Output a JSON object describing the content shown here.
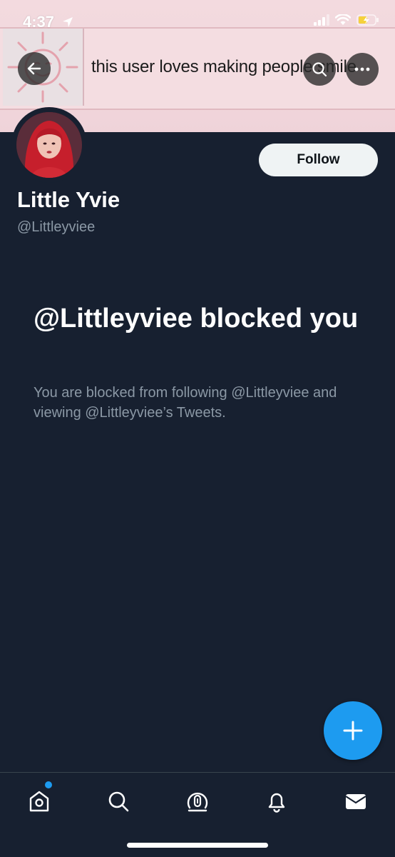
{
  "status_bar": {
    "time": "4:37"
  },
  "banner": {
    "text": "this user loves making people smile"
  },
  "profile": {
    "display_name": "Little Yvie",
    "handle": "@Littleyviee",
    "follow_label": "Follow"
  },
  "blocked": {
    "title": "@Littleyviee blocked you",
    "description": "You are blocked from following @Littleyviee and viewing @Littleyviee’s Tweets."
  },
  "tabbar": {
    "items": [
      "home-icon",
      "search-icon",
      "spaces-icon",
      "notifications-icon",
      "messages-icon"
    ]
  },
  "colors": {
    "background": "#172030",
    "accent": "#1d9bf0",
    "muted_text": "#8b98a5"
  }
}
